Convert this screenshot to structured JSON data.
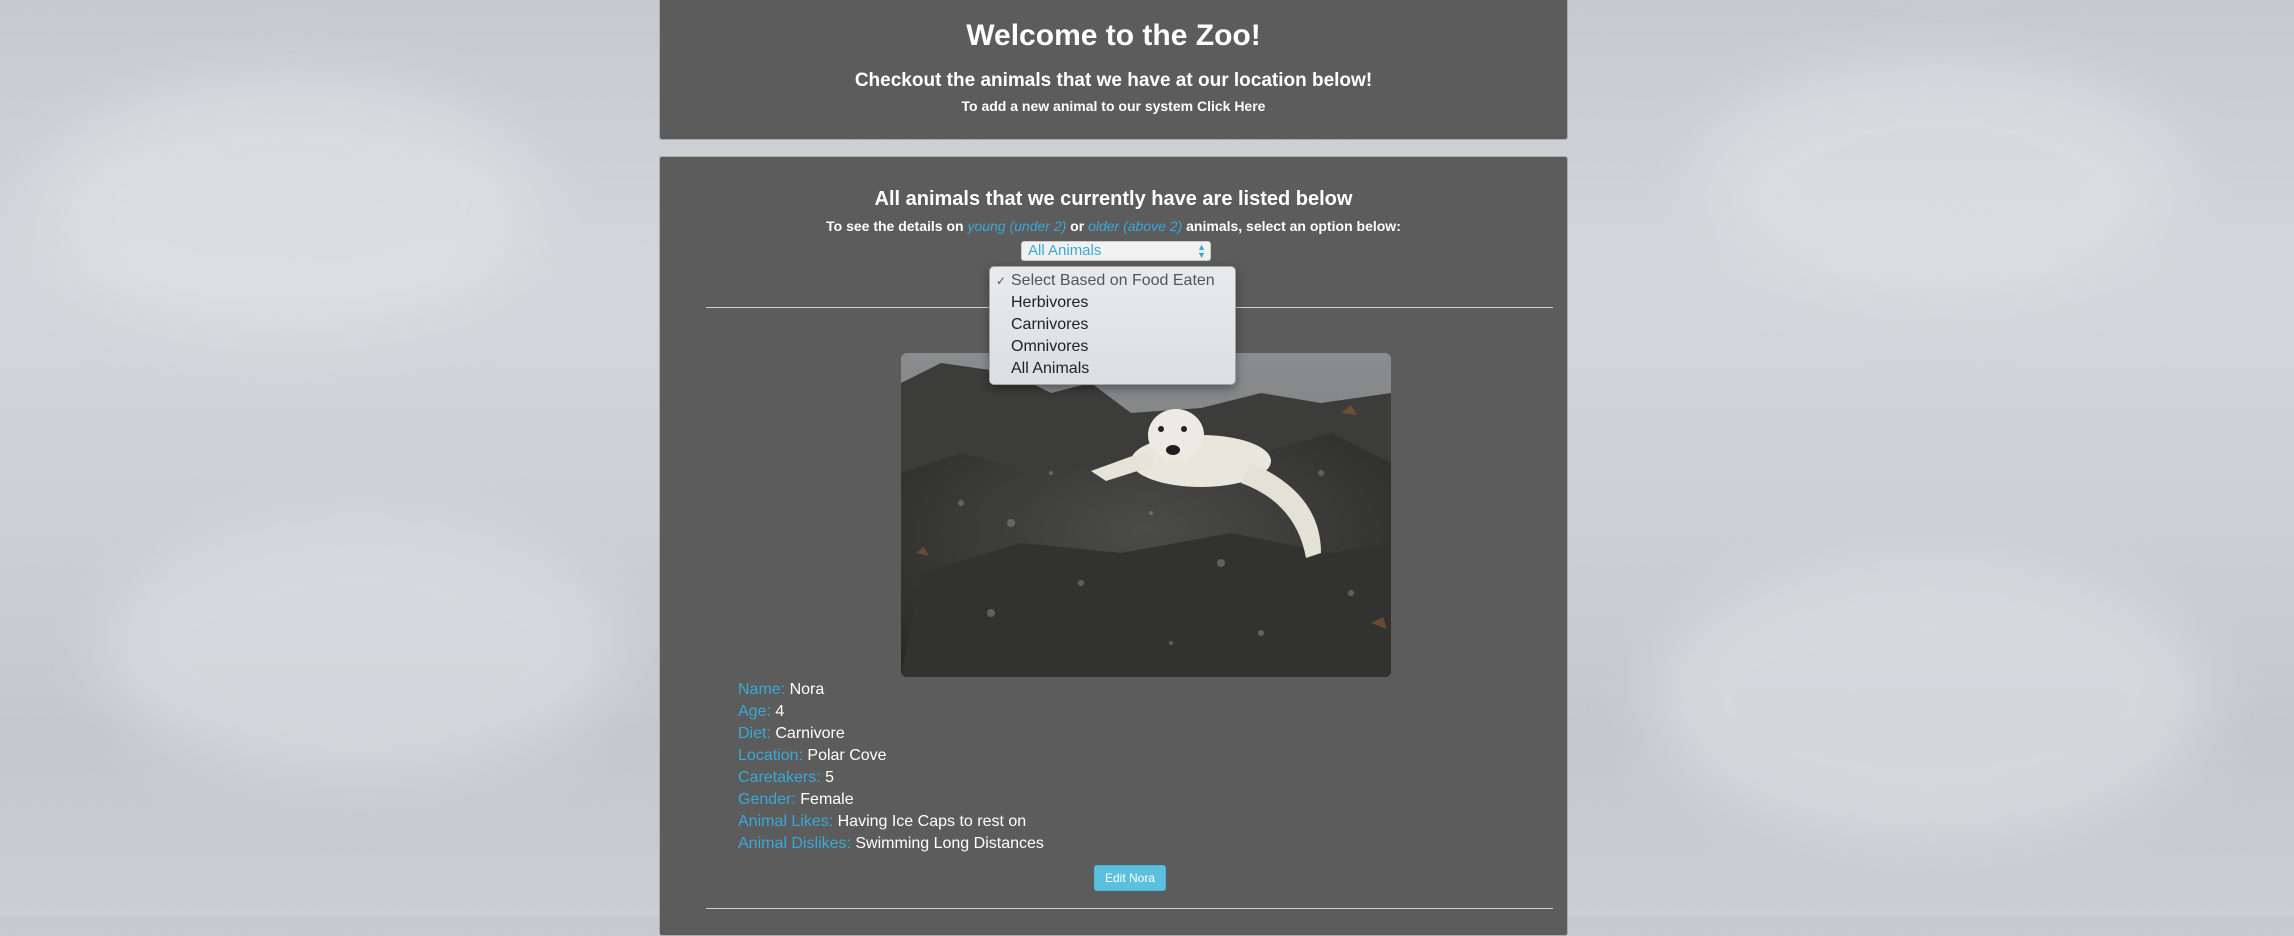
{
  "header": {
    "title": "Welcome to the Zoo!",
    "subtitle": "Checkout the animals that we have at our location below!",
    "add_text": "To add a new animal to our system Click Here"
  },
  "main": {
    "heading": "All animals that we currently have are listed below",
    "details_prefix": "To see the details on ",
    "young_link": "young (under 2)",
    "or_text": " or ",
    "older_link": "older (above 2)",
    "details_suffix": " animals, select an option below:",
    "age_select_value": "All Animals"
  },
  "food_dropdown": {
    "options": [
      "Select Based on Food Eaten",
      "Herbivores",
      "Carnivores",
      "Omnivores",
      "All Animals"
    ],
    "selected_index": 0
  },
  "animal": {
    "fields": [
      {
        "label": "Name:",
        "value": "Nora"
      },
      {
        "label": "Age:",
        "value": "4"
      },
      {
        "label": "Diet:",
        "value": "Carnivore"
      },
      {
        "label": "Location:",
        "value": "Polar Cove"
      },
      {
        "label": "Caretakers:",
        "value": "5"
      },
      {
        "label": "Gender:",
        "value": "Female"
      },
      {
        "label": "Animal Likes:",
        "value": "Having Ice Caps to rest on"
      },
      {
        "label": "Animal Dislikes:",
        "value": "Swimming Long Distances"
      }
    ],
    "edit_label": "Edit Nora"
  },
  "colors": {
    "accent": "#3aa8d8",
    "panel": "#5c5c5c",
    "button": "#5bc0de"
  }
}
